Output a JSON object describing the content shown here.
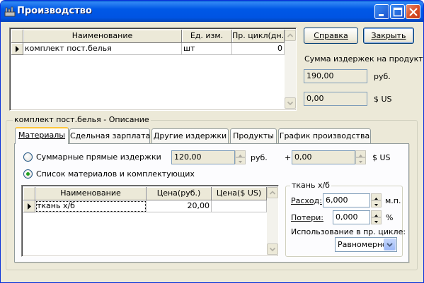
{
  "window": {
    "title": "Производство",
    "minimize_icon": "minimize-icon",
    "maximize_icon": "maximize-icon",
    "close_icon": "close-icon"
  },
  "products_table": {
    "columns": [
      "Наименование",
      "Ед. изм.",
      "Пр. цикл(дн.)"
    ],
    "rows": [
      {
        "name": "комплект пост.белья",
        "unit": "шт",
        "cycle": "0"
      }
    ]
  },
  "buttons": {
    "help": "Справка",
    "close": "Закрыть"
  },
  "cost_summary": {
    "label": "Сумма издержек на продукт:",
    "rub_value": "190,00",
    "rub_unit": "руб.",
    "usd_value": "0,00",
    "usd_unit": "$ US"
  },
  "description": {
    "title": "комплект пост.белья - Описание",
    "tabs": [
      "Материалы",
      "Сдельная зарплата",
      "Другие издержки",
      "Продукты",
      "График производства"
    ],
    "active_tab": 0
  },
  "materials": {
    "radio_direct_label": "Суммарные прямые издержки",
    "radio_list_label": "Список материалов и комплектующих",
    "direct_rub": "120,00",
    "direct_rub_unit": "руб.",
    "plus": "+",
    "direct_usd": "0,00",
    "direct_usd_unit": "$ US",
    "selected": "list",
    "table": {
      "columns": [
        "Наименование",
        "Цена(руб.)",
        "Цена($ US)"
      ],
      "rows": [
        {
          "name": "ткань х/б",
          "price_rub": "20,00",
          "price_usd": ""
        }
      ]
    }
  },
  "material_detail": {
    "title": "ткань х/б",
    "consumption_label": "Расход:",
    "consumption_value": "6,000",
    "consumption_unit": "м.п.",
    "loss_label": "Потери:",
    "loss_value": "0,000",
    "loss_unit": "%",
    "usage_label": "Использование в пр. цикле:",
    "usage_value": "Равномерно"
  }
}
